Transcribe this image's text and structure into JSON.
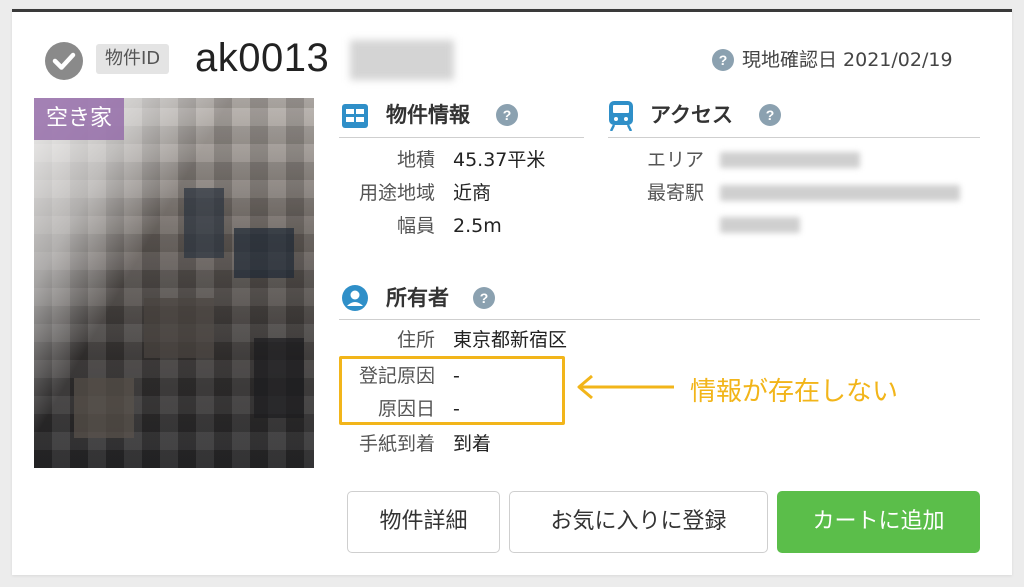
{
  "header": {
    "id_badge": "物件ID",
    "property_id": "ak0013",
    "survey_label": "現地確認日 2021/02/19"
  },
  "photo": {
    "label": "空き家"
  },
  "property_info": {
    "title": "物件情報",
    "rows": [
      {
        "label": "地積",
        "value": "45.37平米"
      },
      {
        "label": "用途地域",
        "value": "近商"
      },
      {
        "label": "幅員",
        "value": "2.5m"
      }
    ]
  },
  "access": {
    "title": "アクセス",
    "area_label": "エリア",
    "station_label": "最寄駅"
  },
  "owner": {
    "title": "所有者",
    "rows": [
      {
        "label": "住所",
        "value": "東京都新宿区"
      },
      {
        "label": "登記原因",
        "value": "-"
      },
      {
        "label": "原因日",
        "value": "-"
      },
      {
        "label": "手紙到着",
        "value": "到着"
      }
    ]
  },
  "annotation": {
    "text": "情報が存在しない",
    "color": "#f2b51a"
  },
  "actions": {
    "detail": "物件詳細",
    "favorite": "お気に入りに登録",
    "cart": "カートに追加"
  },
  "icons": {
    "check": "check-circle-icon",
    "help": "question-circle-icon",
    "info": "grid-icon",
    "access": "train-icon",
    "owner": "user-circle-icon",
    "arrow": "arrow-left-icon"
  },
  "colors": {
    "accent_blue": "#2f8fc8",
    "brand_green": "#5bbe4a",
    "highlight": "#f2b51a",
    "vacant_tag": "#966eaa"
  }
}
